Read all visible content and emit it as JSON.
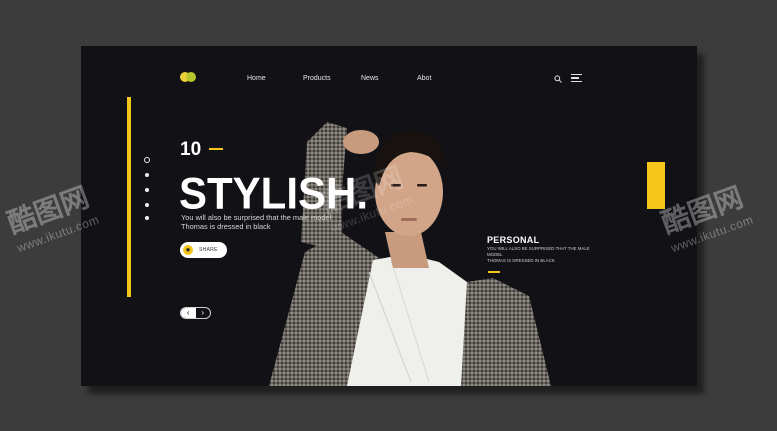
{
  "nav": {
    "items": [
      "Home",
      "Products",
      "News",
      "Abot"
    ]
  },
  "hero": {
    "number": "10",
    "headline": "STYLISH.",
    "subtitle_line1": "You will also be surprised that the male model",
    "subtitle_line2": "Thomas is dressed in black",
    "share_label": "SHARE"
  },
  "side": {
    "title": "PERSONAL",
    "line1": "YOU WILL ALSO BE SURPRISED THAT THE MALE MODEL",
    "line2": "THOMAS IS DRESSED IN BLACK"
  },
  "watermark": {
    "brand": "酷图网",
    "url": "www.ikutu.com"
  },
  "colors": {
    "accent": "#f4c51a",
    "panel": "#111116",
    "background": "#3c3c3c"
  },
  "icons": [
    "logo-icon",
    "search-icon",
    "menu-icon",
    "share-icon",
    "chevron-left-icon",
    "chevron-right-icon"
  ]
}
